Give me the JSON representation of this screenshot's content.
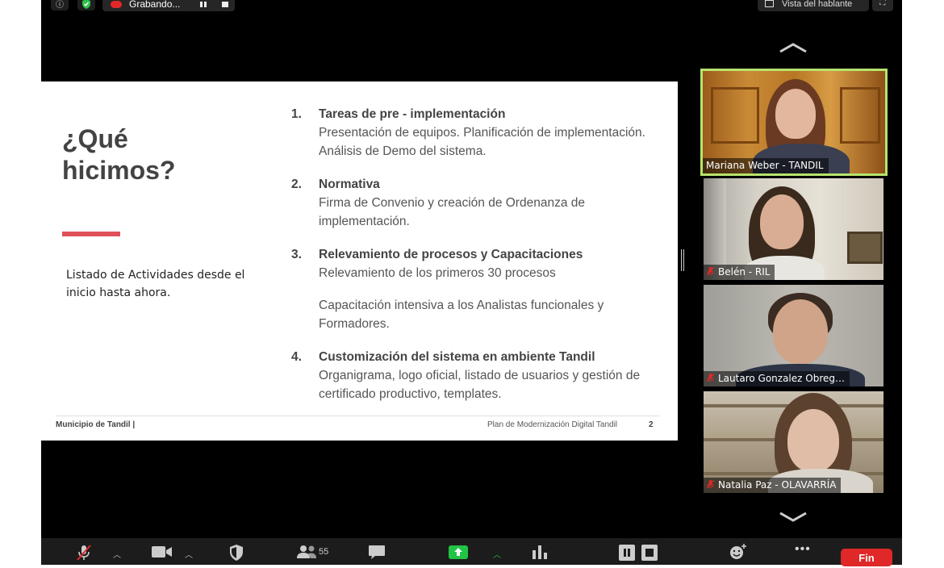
{
  "topbar": {
    "recording_label": "Grabando...",
    "speaker_view_label": "Vista del hablante"
  },
  "slide": {
    "title": "¿Qué hicimos?",
    "subtitle": "Listado de Actividades desde el inicio hasta ahora.",
    "items": [
      {
        "num": "1.",
        "title": "Tareas de pre - implementación",
        "desc": "Presentación de equipos. Planificación de implementación. Análisis de Demo del sistema.",
        "desc2": ""
      },
      {
        "num": "2.",
        "title": "Normativa",
        "desc": "Firma de Convenio y creación de Ordenanza de implementación.",
        "desc2": ""
      },
      {
        "num": "3.",
        "title": "Relevamiento de procesos y Capacitaciones",
        "desc": "Relevamiento de los primeros 30 procesos",
        "desc2": "Capacitación intensiva a los Analistas funcionales y Formadores."
      },
      {
        "num": "4.",
        "title": "Customización del sistema en ambiente Tandil",
        "desc": "Organigrama, logo oficial, listado de usuarios y gestión de certificado productivo, templates.",
        "desc2": ""
      }
    ],
    "footer_left": "Municipio de Tandil |",
    "footer_right": "Plan de Modernización Digital Tandil",
    "page_number": "2",
    "accent_color": "#e0505a"
  },
  "participants": [
    {
      "name": "Mariana Weber - TANDIL",
      "active": true,
      "muted": false
    },
    {
      "name": "Belén - RIL",
      "active": false,
      "muted": true
    },
    {
      "name": "Lautaro Gonzalez Obreg…",
      "active": false,
      "muted": true
    },
    {
      "name": "Natalia Paz - OLAVARRÍA",
      "active": false,
      "muted": true
    }
  ],
  "toolbar": {
    "participants_count": "55",
    "end_label": "Fin",
    "end_color": "#e02828"
  },
  "icons": [
    "info-icon",
    "shield-check-icon",
    "pause-icon",
    "stop-icon",
    "chevron-up-icon",
    "chevron-down-icon",
    "mic-muted-icon",
    "video-icon",
    "security-icon",
    "participants-icon",
    "chat-icon",
    "share-screen-icon",
    "polls-icon",
    "recording-icon",
    "reactions-icon",
    "more-icon",
    "fullscreen-icon"
  ]
}
